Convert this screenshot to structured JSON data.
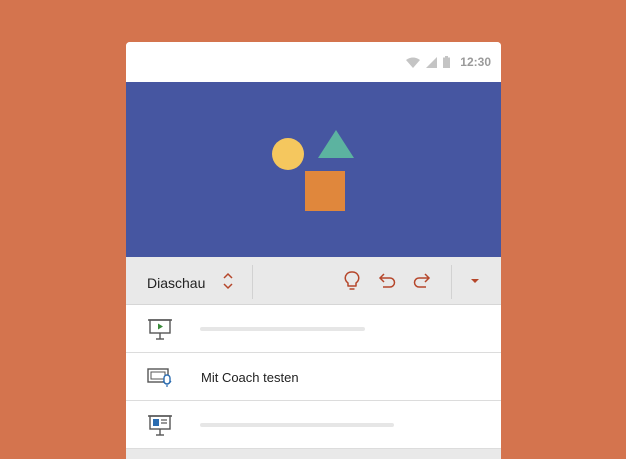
{
  "status_bar": {
    "time": "12:30",
    "icons": [
      "wifi-icon",
      "cellular-signal-icon",
      "battery-icon"
    ]
  },
  "slide": {
    "shapes": [
      "circle",
      "triangle",
      "square"
    ],
    "colors": {
      "background": "#4656a1",
      "circle": "#f5c75e",
      "triangle": "#5cb3a0",
      "square": "#e0873c"
    }
  },
  "toolbar": {
    "mode_label": "Diaschau",
    "icons": [
      "up-down-chevron-icon",
      "lightbulb-icon",
      "undo-icon",
      "redo-icon",
      "dropdown-arrow-icon"
    ],
    "accent_color": "#b5462a"
  },
  "menu": {
    "items": [
      {
        "icon": "present-from-start-icon",
        "label": ""
      },
      {
        "icon": "rehearse-with-coach-icon",
        "label": "Mit Coach testen"
      },
      {
        "icon": "presenter-view-icon",
        "label": ""
      }
    ]
  },
  "colors": {
    "page_background": "#d4744e",
    "toolbar_background": "#e9e9e9"
  }
}
